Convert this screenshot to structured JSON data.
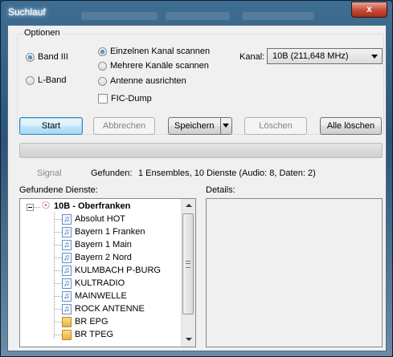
{
  "window": {
    "title": "Suchlauf",
    "close_glyph": "x"
  },
  "options": {
    "group_label": "Optionen",
    "band": [
      {
        "label": "Band III",
        "checked": true
      },
      {
        "label": "L-Band",
        "checked": false
      }
    ],
    "scan_modes": [
      {
        "label": "Einzelnen Kanal scannen",
        "checked": true
      },
      {
        "label": "Mehrere Kanäle scannen",
        "checked": false
      },
      {
        "label": "Antenne ausrichten",
        "checked": false
      }
    ],
    "fic_dump": {
      "label": "FIC-Dump",
      "checked": false
    },
    "kanal_label": "Kanal:",
    "kanal_value": "10B (211,648 MHz)"
  },
  "buttons": {
    "start": "Start",
    "abbrechen": "Abbrechen",
    "speichern": "Speichern",
    "loeschen": "Löschen",
    "alle_loeschen": "Alle löschen"
  },
  "progress": {
    "value": 0
  },
  "status": {
    "signal_label": "Signal",
    "gefunden_label": "Gefunden:",
    "gefunden_value": "1 Ensembles, 10 Dienste (Audio: 8, Daten: 2)"
  },
  "tree": {
    "label": "Gefundene Dienste:",
    "root": "10B - Oberfranken",
    "items": [
      {
        "label": "Absolut HOT",
        "icon": "music-note-icon"
      },
      {
        "label": "Bayern 1 Franken",
        "icon": "music-note-icon"
      },
      {
        "label": "Bayern 1 Main",
        "icon": "music-note-icon"
      },
      {
        "label": "Bayern 2 Nord",
        "icon": "music-note-icon"
      },
      {
        "label": "KULMBACH P-BURG",
        "icon": "music-note-icon"
      },
      {
        "label": "KULTRADIO",
        "icon": "music-note-icon"
      },
      {
        "label": "MAINWELLE",
        "icon": "music-note-icon"
      },
      {
        "label": "ROCK ANTENNE",
        "icon": "music-note-icon"
      },
      {
        "label": "BR EPG",
        "icon": "folder-icon"
      },
      {
        "label": "BR TPEG",
        "icon": "folder-icon"
      }
    ]
  },
  "details": {
    "label": "Details:"
  }
}
